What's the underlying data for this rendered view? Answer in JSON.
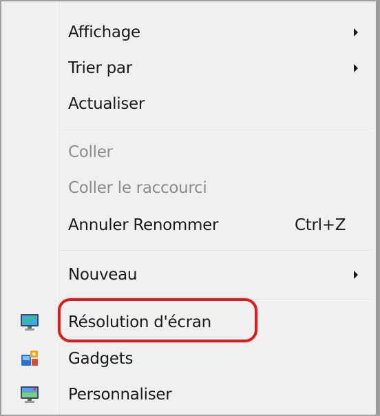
{
  "menu": {
    "items": [
      {
        "label": "Affichage",
        "submenu": true,
        "disabled": false
      },
      {
        "label": "Trier par",
        "submenu": true,
        "disabled": false
      },
      {
        "label": "Actualiser",
        "submenu": false,
        "disabled": false
      },
      {
        "label": "Coller",
        "submenu": false,
        "disabled": true
      },
      {
        "label": "Coller le raccourci",
        "submenu": false,
        "disabled": true
      },
      {
        "label": "Annuler Renommer",
        "shortcut": "Ctrl+Z",
        "submenu": false,
        "disabled": false
      },
      {
        "label": "Nouveau",
        "submenu": true,
        "disabled": false
      },
      {
        "label": "Résolution d'écran",
        "icon": "screen-resolution-icon",
        "submenu": false,
        "disabled": false,
        "highlighted": true
      },
      {
        "label": "Gadgets",
        "icon": "gadgets-icon",
        "submenu": false,
        "disabled": false
      },
      {
        "label": "Personnaliser",
        "icon": "personalize-icon",
        "submenu": false,
        "disabled": false
      }
    ]
  },
  "colors": {
    "highlight_ring": "#d41f1f",
    "disabled_text": "#8d8d8d",
    "menu_background": "#f0f0f0"
  }
}
